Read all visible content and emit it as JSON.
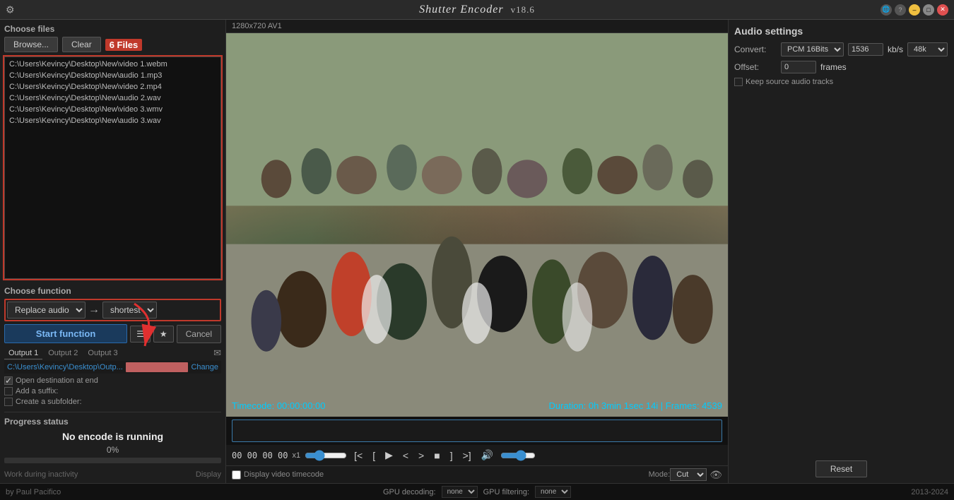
{
  "app": {
    "title": "Shutter Encoder",
    "version": "v18.6"
  },
  "titlebar": {
    "title": "Shutter Encoder  v18.6",
    "settings_icon": "⚙",
    "globe_label": "🌐",
    "help_label": "?",
    "minimize_label": "–",
    "maximize_label": "□",
    "close_label": "✕"
  },
  "left": {
    "choose_files_label": "Choose files",
    "browse_label": "Browse...",
    "clear_label": "Clear",
    "files_count": "6 Files",
    "files": [
      "C:\\Users\\Kevincy\\Desktop\\New\\video 1.webm",
      "C:\\Users\\Kevincy\\Desktop\\New\\audio 1.mp3",
      "C:\\Users\\Kevincy\\Desktop\\New\\video 2.mp4",
      "C:\\Users\\Kevincy\\Desktop\\New\\audio 2.wav",
      "C:\\Users\\Kevincy\\Desktop\\New\\video 3.wmv",
      "C:\\Users\\Kevincy\\Desktop\\New\\audio 3.wav"
    ],
    "choose_function_label": "Choose function",
    "function_value": "Replace audio",
    "function_arrow": "→",
    "shortest_value": "shortest",
    "start_function_label": "Start function",
    "cancel_label": "Cancel",
    "output_tabs": [
      "Output 1",
      "Output 2",
      "Output 3"
    ],
    "output_path": "C:\\Users\\Kevincy\\Desktop\\Outp...",
    "open_destination_label": "Open destination at end",
    "change_label": "Change",
    "add_suffix_label": "Add a suffix:",
    "create_subfolder_label": "Create a subfolder:",
    "progress_status_label": "Progress status",
    "no_encode_label": "No encode is running",
    "progress_pct": "0%",
    "work_during_label": "Work during inactivity",
    "display_label": "Display"
  },
  "video": {
    "info": "1280x720 AV1",
    "timecode_label": "Timecode: 00:00:00:00",
    "duration_label": "Duration: 0h 3min 1sec 14i | Frames: 4539",
    "timecode_display": "00 00 00 00",
    "speed_label": "x1",
    "display_timecode_label": "Display video timecode",
    "mode_label": "Mode:",
    "mode_value": "Cut"
  },
  "right": {
    "title": "Audio settings",
    "convert_label": "Convert:",
    "convert_value": "PCM 16Bits",
    "kbps_value": "1536",
    "kbps_unit": "kb/s",
    "khz_value": "48k",
    "offset_label": "Offset:",
    "offset_value": "0",
    "frames_label": "frames",
    "keep_source_label": "Keep source audio tracks",
    "reset_label": "Reset"
  },
  "statusbar": {
    "author": "by Paul Pacifico",
    "gpu_decode_label": "GPU decoding:",
    "gpu_decode_value": "none",
    "gpu_filter_label": "GPU filtering:",
    "gpu_filter_value": "none",
    "year": "2013-2024"
  }
}
